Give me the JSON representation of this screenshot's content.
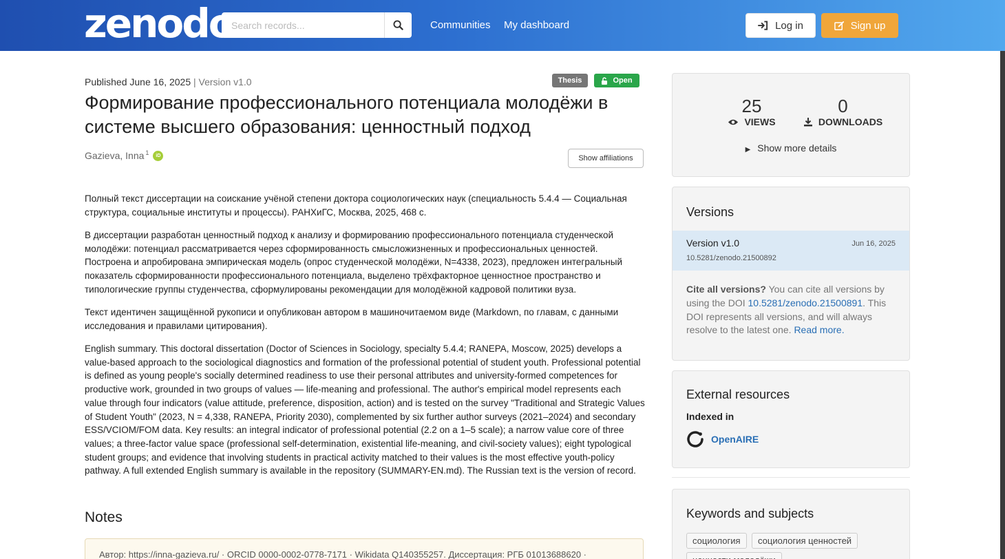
{
  "header": {
    "logo": "zenodo",
    "search_placeholder": "Search records...",
    "nav": [
      "Communities",
      "My dashboard"
    ],
    "login_label": "Log in",
    "signup_label": "Sign up"
  },
  "record": {
    "published": "Published June 16, 2025",
    "separator": "|",
    "version_label": "Version v1.0",
    "badges": {
      "type": "Thesis",
      "access": "Open"
    },
    "title": "Формирование профессионального потенциала молодёжи в системе высшего образования: ценностный подход",
    "author": "Gazieva, Inna",
    "author_affil_index": "1",
    "orcid_icon_text": "iD",
    "show_affiliations_label": "Show affiliations",
    "description": [
      "Полный текст диссертации на соискание учёной степени доктора социологических наук (специальность 5.4.4 — Социальная структура, социальные институты и процессы). РАНХиГС, Москва, 2025, 468 с.",
      "В диссертации разработан ценностный подход к анализу и формированию профессионального потенциала студенческой молодёжи: потенциал рассматривается через сформированность смысложизненных и профессиональных ценностей. Построена и апробирована эмпирическая модель (опрос студенческой молодёжи, N=4338, 2023), предложен интегральный показатель сформированности профессионального потенциала, выделено трёхфакторное ценностное пространство и типологические группы студенчества, сформулированы рекомендации для молодёжной кадровой политики вуза.",
      "Текст идентичен защищённой рукописи и опубликован автором в машиночитаемом виде (Markdown, по главам, с данными исследования и правилами цитирования).",
      "English summary. This doctoral dissertation (Doctor of Sciences in Sociology, specialty 5.4.4; RANEPA, Moscow, 2025) develops a value-based approach to the sociological diagnostics and formation of the professional potential of student youth. Professional potential is defined as young people's socially determined readiness to use their personal attributes and university-formed competences for productive work, grounded in two groups of values — life-meaning and professional. The author's empirical model represents each value through four indicators (value attitude, preference, disposition, action) and is tested on the survey \"Traditional and Strategic Values of Student Youth\" (2023, N = 4,338, RANEPA, Priority 2030), complemented by six further author surveys (2021–2024) and secondary ESS/VCIOM/FOM data. Key results: an integral indicator of professional potential (2.2 on a 1–5 scale); a narrow value core of three values; a three-factor value space (professional self-determination, existential life-meaning, and civil-society values); eight typological student groups; and evidence that involving students in practical activity matched to their values is the most effective youth-policy pathway. A full extended English summary is available in the repository (SUMMARY-EN.md). The Russian text is the version of record."
    ],
    "notes_heading": "Notes",
    "notes_text": "Автор: https://inna-gazieva.ru/ · ORCID 0000-0002-0778-7171 · Wikidata Q140355257. Диссертация: РГБ 01013688620 ·"
  },
  "sidebar": {
    "stats": {
      "views": "25",
      "views_label": "VIEWS",
      "downloads": "0",
      "downloads_label": "DOWNLOADS",
      "more_details": "Show more details"
    },
    "versions": {
      "heading": "Versions",
      "item": {
        "name": "Version v1.0",
        "date": "Jun 16, 2025",
        "doi": "10.5281/zenodo.21500892"
      },
      "cite_bold": "Cite all versions?",
      "cite_text1": " You can cite all versions by using the DOI ",
      "cite_doi": "10.5281/zenodo.21500891",
      "cite_text2": ". This DOI represents all versions, and will always resolve to the latest one. ",
      "read_more": "Read more."
    },
    "external": {
      "heading": "External resources",
      "indexed_in": "Indexed in",
      "resource": "OpenAIRE"
    },
    "keywords": {
      "heading": "Keywords and subjects",
      "tags": [
        "социология",
        "социология ценностей",
        "ценности молодёжи"
      ]
    }
  },
  "colors": {
    "header_start": "#1f4fb0",
    "header_end": "#52a8ee",
    "signup": "#f0a63a",
    "open_badge": "#2aa64a",
    "thesis_badge": "#767676",
    "link": "#2a6fb5",
    "version_highlight": "#dbe9f5"
  }
}
